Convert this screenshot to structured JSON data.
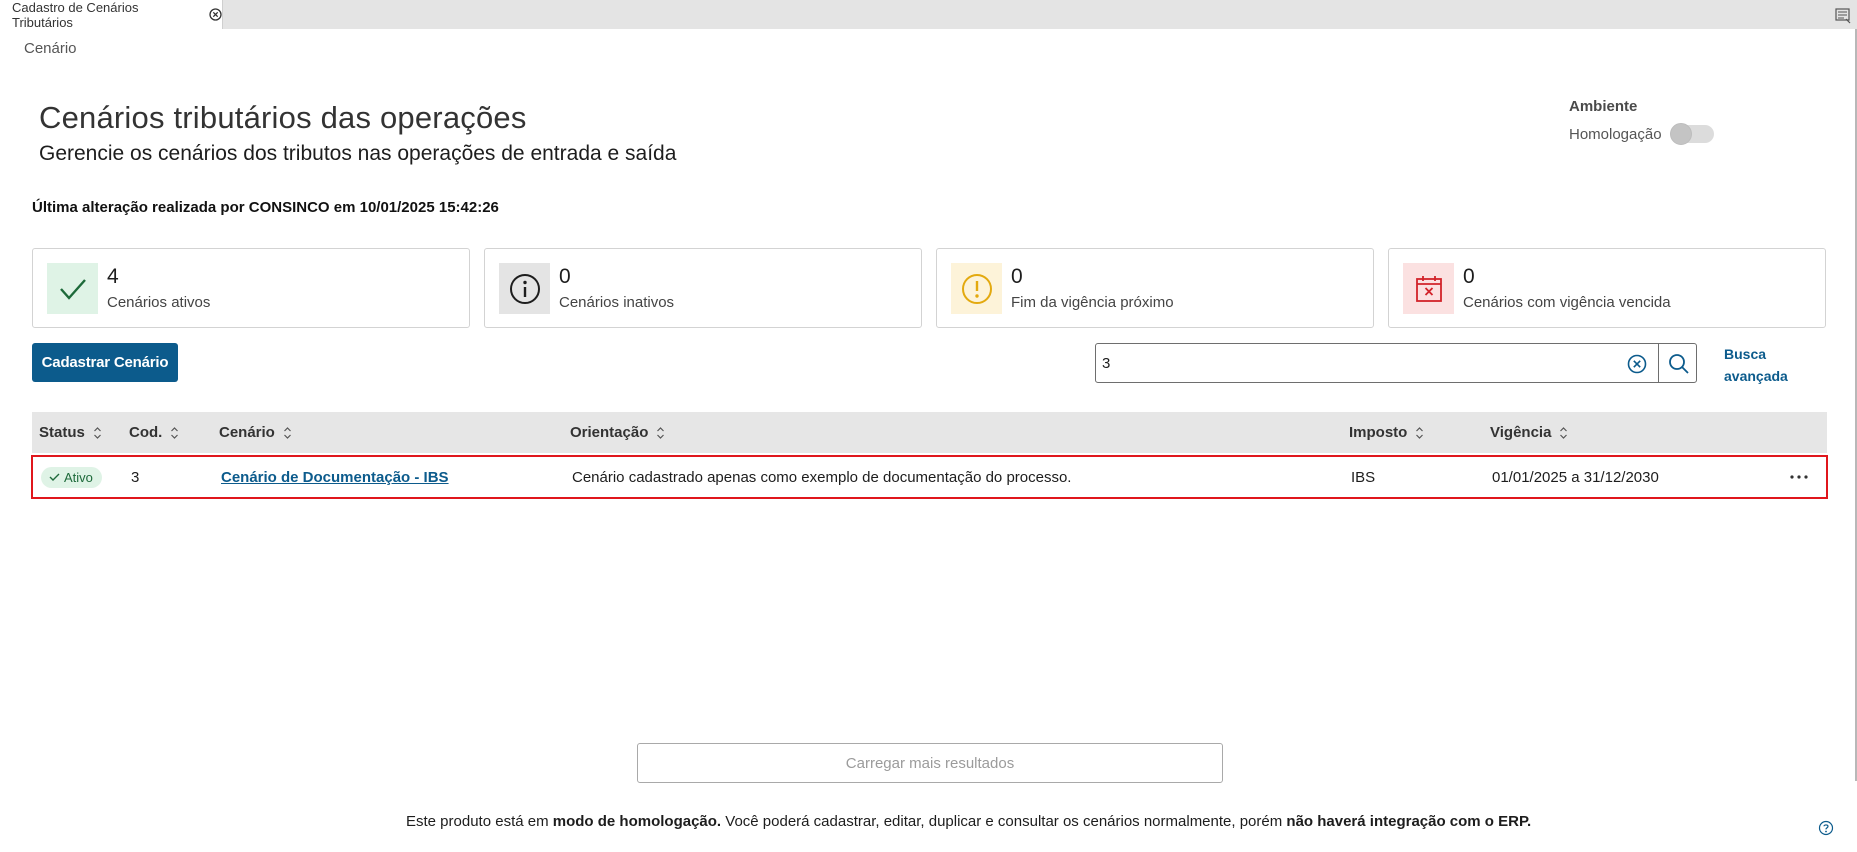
{
  "tab": {
    "title": "Cadastro de Cenários Tributários"
  },
  "breadcrumb": "Cenário",
  "header": {
    "title": "Cenários tributários das operações",
    "subtitle": "Gerencie os cenários dos tributos nas operações de entrada e saída"
  },
  "ambiente": {
    "label": "Ambiente",
    "mode": "Homologação",
    "toggle_on": false
  },
  "last_change": "Última alteração realizada por CONSINCO em 10/01/2025 15:42:26",
  "cards": [
    {
      "count": "4",
      "label": "Cenários ativos",
      "icon": "check-icon",
      "bg": "#dff3e6",
      "color": "#1d6a3a"
    },
    {
      "count": "0",
      "label": "Cenários inativos",
      "icon": "info-icon",
      "bg": "#e4e4e4",
      "color": "#1d1d1d"
    },
    {
      "count": "0",
      "label": "Fim da vigência próximo",
      "icon": "warning-icon",
      "bg": "#fdf3d9",
      "color": "#e3a90f"
    },
    {
      "count": "0",
      "label": "Cenários com vigência vencida",
      "icon": "calendar-x-icon",
      "bg": "#fbe1e1",
      "color": "#d2232a"
    }
  ],
  "actions": {
    "new_button": "Cadastrar Cenário",
    "advanced_line1": "Busca",
    "advanced_line2": "avançada"
  },
  "search": {
    "value": "3",
    "placeholder": ""
  },
  "table": {
    "columns": [
      "Status",
      "Cod.",
      "Cenário",
      "Orientação",
      "Imposto",
      "Vigência"
    ],
    "rows": [
      {
        "status": "Ativo",
        "code": "3",
        "scenario": "Cenário de Documentação - IBS",
        "orientation": "Cenário cadastrado apenas como exemplo de documentação do processo.",
        "tax": "IBS",
        "validity": "01/01/2025 a 31/12/2030"
      }
    ]
  },
  "load_more": "Carregar mais resultados",
  "footer": {
    "part1": "Este produto está em ",
    "bold1": "modo de homologação.",
    "part2": " Você poderá cadastrar, editar, duplicar e consultar os cenários normalmente, porém ",
    "bold2": "não haverá integração com o ERP."
  },
  "colors": {
    "primary": "#0c5b8c",
    "highlight_border": "#e0161c",
    "header_bg": "#e6e6e6"
  }
}
